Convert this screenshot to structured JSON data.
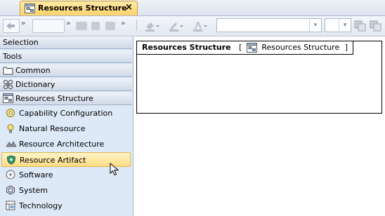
{
  "tab": {
    "title": "Resources Structure",
    "close": "×",
    "icon": "diagram-icon"
  },
  "toolbar": {
    "chevron": "»",
    "combo_arrow": "▾"
  },
  "palette": {
    "sections": [
      {
        "label": "Selection"
      },
      {
        "label": "Tools"
      },
      {
        "label": "Common",
        "icon": "folder-icon"
      },
      {
        "label": "Dictionary",
        "icon": "dictionary-icon"
      },
      {
        "label": "Resources Structure",
        "icon": "diagram-icon"
      }
    ],
    "items": [
      {
        "label": "Capability Configuration",
        "icon": "capability-configuration-icon"
      },
      {
        "label": "Natural Resource",
        "icon": "natural-resource-icon"
      },
      {
        "label": "Resource Architecture",
        "icon": "resource-architecture-icon"
      },
      {
        "label": "Resource Artifact",
        "icon": "resource-artifact-icon",
        "selected": true
      },
      {
        "label": "Software",
        "icon": "software-icon"
      },
      {
        "label": "System",
        "icon": "system-icon"
      },
      {
        "label": "Technology",
        "icon": "technology-icon"
      }
    ]
  },
  "diagram": {
    "frame_name": "Resources Structure",
    "frame_open": "[",
    "frame_type": "Resources Structure",
    "frame_close": "]"
  }
}
